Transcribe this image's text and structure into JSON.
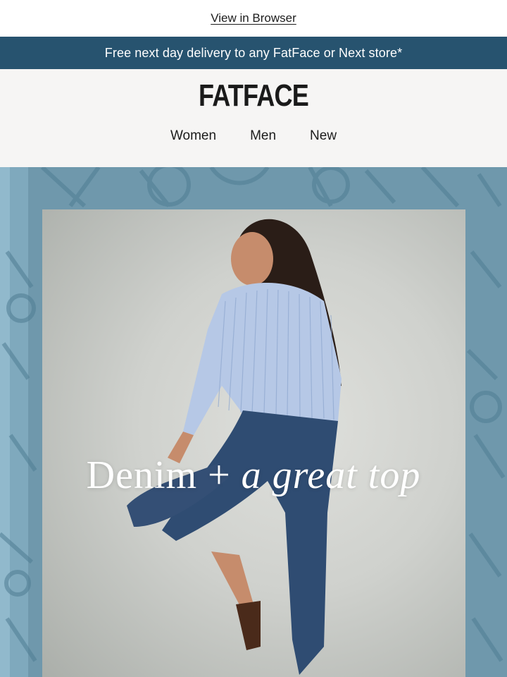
{
  "top_bar": {
    "view_in_browser": "View in Browser"
  },
  "promo": {
    "text": "Free next day delivery to any FatFace or Next store*",
    "background": "#27536f"
  },
  "header": {
    "logo_text": "FATFACE",
    "nav": [
      {
        "label": "Women"
      },
      {
        "label": "Men"
      },
      {
        "label": "New"
      }
    ]
  },
  "hero": {
    "headline_plain": "Denim +",
    "headline_italic": "a great top",
    "background_color": "#6f98ac",
    "image": "woman-in-striped-shirt-and-jeans-photo"
  }
}
